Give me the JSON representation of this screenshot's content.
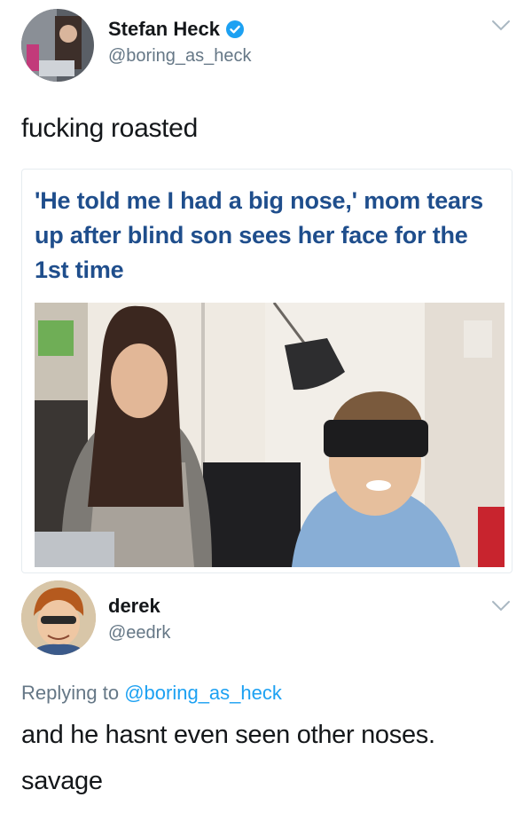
{
  "tweet": {
    "display_name": "Stefan Heck",
    "handle": "@boring_as_heck",
    "text": "fucking roasted",
    "verified": true,
    "card": {
      "headline": "'He told me I had a big nose,' mom tears up after blind son sees her face for the 1st time"
    }
  },
  "reply": {
    "display_name": "derek",
    "handle": "@eedrk",
    "replying_prefix": "Replying to",
    "replying_mention": "@boring_as_heck",
    "text_line1": "and he hasnt even seen other noses.",
    "text_line2": "savage"
  },
  "icons": {
    "verified": "verified-badge-icon",
    "chevron": "chevron-down-icon"
  },
  "colors": {
    "verified_blue": "#1da1f2",
    "link_blue": "#1da1f2",
    "headline_blue": "#1f4e8c",
    "muted_gray": "#657786"
  }
}
